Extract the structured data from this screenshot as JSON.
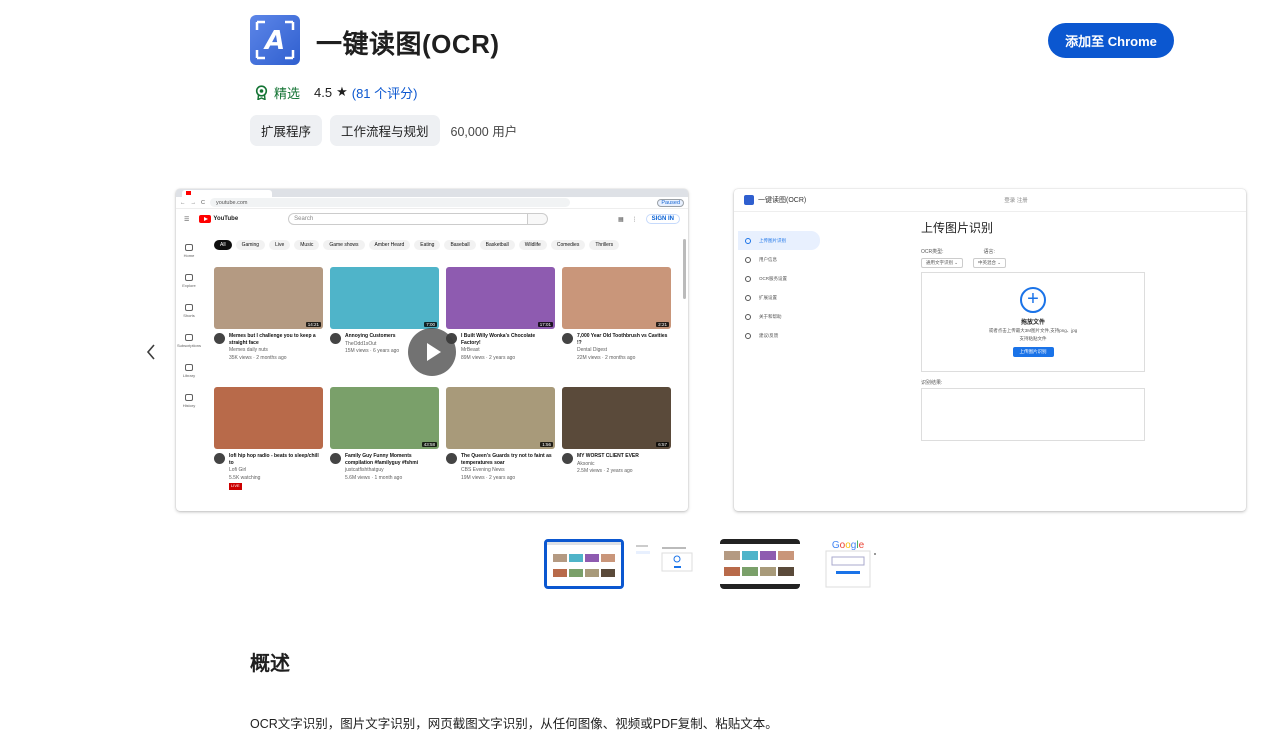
{
  "extension": {
    "title": "一键读图(OCR)",
    "add_button_label": "添加至 Chrome",
    "featured_label": "精选",
    "rating": "4.5",
    "star": "★",
    "reviews_label": "(81 个评分)",
    "chips": [
      "扩展程序",
      "工作流程与规划"
    ],
    "users": "60,000 用户"
  },
  "colors": {
    "accent": "#0b57d0",
    "featured": "#137333",
    "chip_bg": "#eef0f3"
  },
  "screenshot1": {
    "url": "youtube.com",
    "search_placeholder": "Search",
    "sign_in": "SIGN IN",
    "paused": "Paused",
    "logo_text": "YouTube",
    "sidebar": [
      "Home",
      "Explore",
      "Shorts",
      "Subscriptions",
      "Library",
      "History"
    ],
    "chips": [
      "All",
      "Gaming",
      "Live",
      "Music",
      "Game shows",
      "Amber Heard",
      "Eating",
      "Baseball",
      "Basketball",
      "Wildlife",
      "Comedies",
      "Thrillers"
    ],
    "videos": [
      {
        "title": "Memes but I challenge you to keep a straight face",
        "channel": "Memes daily nuts",
        "meta": "35K views · 2 months ago",
        "duration": "14:21",
        "color": "#b49a82"
      },
      {
        "title": "Annoying Customers",
        "channel": "TheOdd1sOut",
        "meta": "15M views · 6 years ago",
        "duration": "7:00",
        "color": "#4fb4c9"
      },
      {
        "title": "I Built Willy Wonka's Chocolate Factory!",
        "channel": "MrBeast",
        "meta": "89M views · 2 years ago",
        "duration": "17:01",
        "color": "#8e5bb0"
      },
      {
        "title": "7,000 Year Old Toothbrush vs Cavities !?",
        "channel": "Dental Digest",
        "meta": "22M views · 2 months ago",
        "duration": "2:21",
        "color": "#c9967a"
      },
      {
        "title": "lofi hip hop radio - beats to sleep/chill to",
        "channel": "Lofi Girl",
        "meta": "5.5K watching",
        "duration": "",
        "live": "LIVE",
        "color": "#b86a4a"
      },
      {
        "title": "Family Guy Funny Moments compilation #familyguy #fshmi",
        "channel": "justcatfishthatguy",
        "meta": "5.6M views · 1 month ago",
        "duration": "43:58",
        "color": "#7aa06a"
      },
      {
        "title": "The Queen's Guards try not to faint as temperatures soar",
        "channel": "CBS Evening News",
        "meta": "19M views · 2 years ago",
        "duration": "1:56",
        "color": "#a89a7a"
      },
      {
        "title": "MY WORST CLIENT EVER",
        "channel": "Aksonic",
        "meta": "2.5M views · 2 years ago",
        "duration": "6:57",
        "color": "#5a4a3a"
      }
    ]
  },
  "screenshot2": {
    "app_title": "一键读图(OCR)",
    "login": "登录  注册",
    "sidebar": [
      "上传图片识别",
      "用户信息",
      "OCR服务设置",
      "扩展设置",
      "关于和帮助",
      "建议/反馈"
    ],
    "heading": "上传图片识别",
    "ocr_type_label": "OCR类型:",
    "lang_label": "语言:",
    "ocr_type_value": "通用文字识别",
    "lang_value": "中英混合",
    "drop_title": "拖放文件",
    "drop_hint": "或者点击上传最大3M图片文件,支持png、jpg",
    "drop_hint2": "支持粘贴文件",
    "upload_button": "上传图片识别",
    "result_label": "识别结果:"
  },
  "overview": {
    "heading": "概述",
    "text": "OCR文字识别，图片文字识别，网页截图文字识别，从任何图像、视频或PDF复制、粘贴文本。"
  }
}
